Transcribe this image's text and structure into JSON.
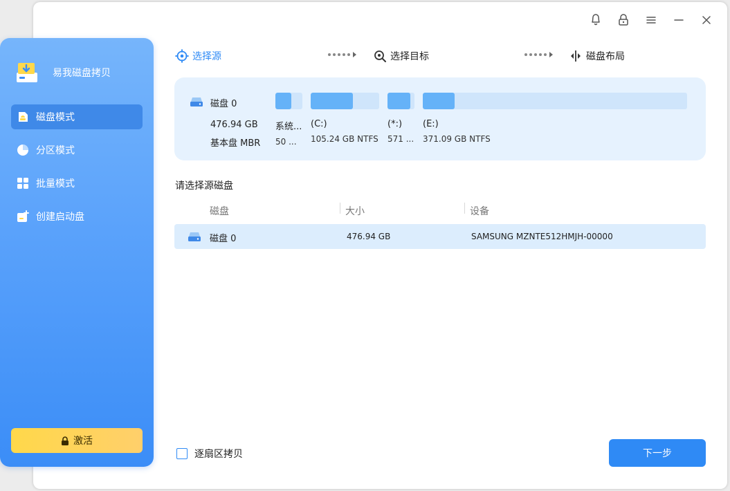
{
  "app": {
    "name": "易我磁盘拷贝"
  },
  "sidebar": {
    "items": [
      {
        "label": "磁盘模式",
        "icon": "disk-mode-icon",
        "active": true
      },
      {
        "label": "分区模式",
        "icon": "pie-chart-icon",
        "active": false
      },
      {
        "label": "批量模式",
        "icon": "grid-icon",
        "active": false
      },
      {
        "label": "创建启动盘",
        "icon": "boot-disk-icon",
        "active": false
      }
    ],
    "activate_label": "激活"
  },
  "titlebar": {
    "icons": [
      "bell-icon",
      "lock-icon",
      "menu-icon",
      "minimize-icon",
      "close-icon"
    ]
  },
  "steps": [
    {
      "label": "选择源",
      "icon": "target-icon",
      "active": true
    },
    {
      "label": "选择目标",
      "icon": "search-target-icon",
      "active": false
    },
    {
      "label": "磁盘布局",
      "icon": "layout-icon",
      "active": false
    }
  ],
  "disk_card": {
    "name": "磁盘 0",
    "size": "476.94 GB",
    "type": "基本盘 MBR",
    "partitions": [
      {
        "label": "系统...",
        "detail": "50 ...",
        "fill": 0.6
      },
      {
        "label": "(C:)",
        "detail": "105.24 GB NTFS",
        "fill": 0.62
      },
      {
        "label": "(*:)",
        "detail": "571 ...",
        "fill": 0.85
      },
      {
        "label": "(E:)",
        "detail": "371.09 GB NTFS",
        "fill": 0.12
      }
    ]
  },
  "table": {
    "title": "请选择源磁盘",
    "headers": {
      "disk": "磁盘",
      "size": "大小",
      "device": "设备"
    },
    "rows": [
      {
        "disk": "磁盘 0",
        "size": "476.94 GB",
        "device": "SAMSUNG MZNTE512HMJH-00000"
      }
    ]
  },
  "footer": {
    "sector_copy_label": "逐扇区拷贝",
    "sector_copy_checked": false,
    "next_label": "下一步"
  },
  "colors": {
    "accent": "#2f8af5",
    "sidebar_top": "#76b5fb",
    "sidebar_bottom": "#3b8df7",
    "activate": "#ffd84a",
    "card_bg": "#e6f2fe",
    "partition_fill": "#65b2f8"
  }
}
